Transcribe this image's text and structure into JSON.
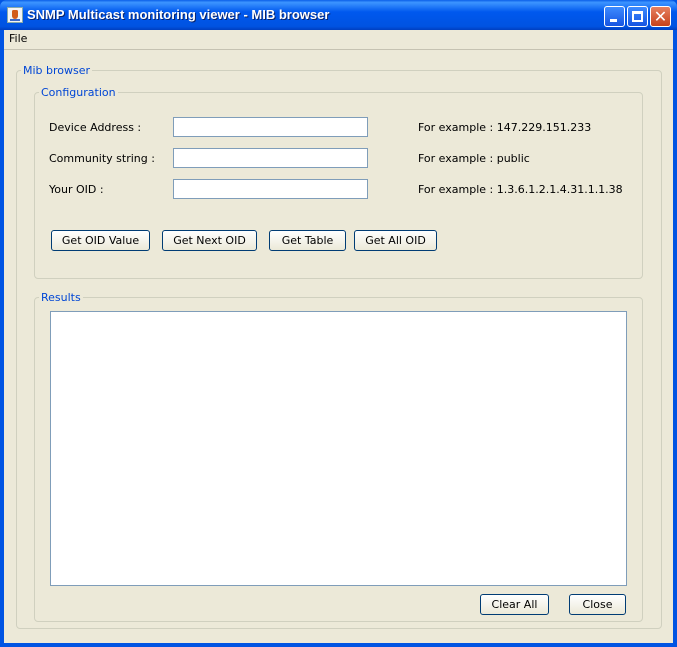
{
  "window": {
    "title": "SNMP Multicast monitoring viewer - MIB browser",
    "controls": {
      "minimize": "minimize-icon",
      "maximize": "maximize-icon",
      "close": "close-icon"
    }
  },
  "menu": {
    "file": "File"
  },
  "mib_browser": {
    "title": "Mib browser",
    "configuration": {
      "title": "Configuration",
      "fields": [
        {
          "label": "Device Address :",
          "value": "",
          "example": "For example : 147.229.151.233"
        },
        {
          "label": "Community string :",
          "value": "",
          "example": "For example : public"
        },
        {
          "label": "Your OID :",
          "value": "",
          "example": "For example : 1.3.6.1.2.1.4.31.1.1.38"
        }
      ],
      "buttons": [
        "Get OID Value",
        "Get Next OID",
        "Get Table",
        "Get All OID"
      ]
    },
    "results": {
      "title": "Results",
      "text": "",
      "buttons": {
        "clear": "Clear All",
        "close": "Close"
      }
    }
  },
  "colors": {
    "titlebar": "#0058ee",
    "panel": "#ece9d8",
    "legend": "#0046d5",
    "border": "#7f9db9"
  }
}
